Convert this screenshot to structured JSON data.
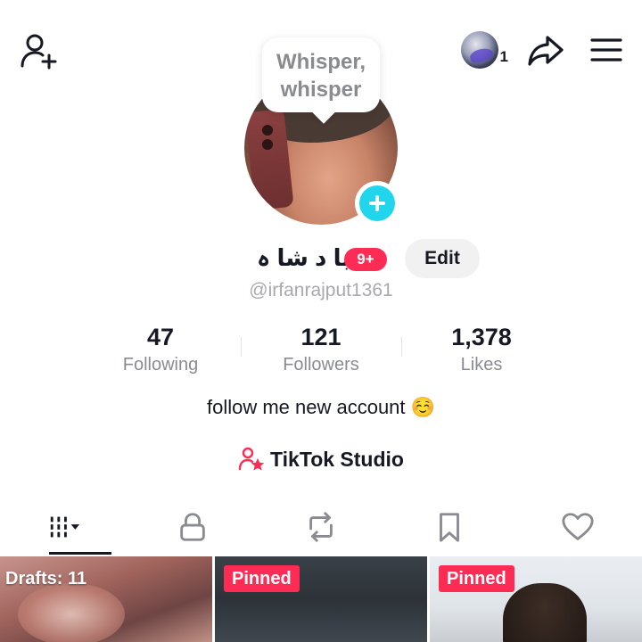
{
  "header": {
    "add_friend_icon": "add-user-icon",
    "story_count": "1",
    "share_icon": "share-icon",
    "menu_icon": "menu-icon"
  },
  "avatar": {
    "note_text": "Whisper, whisper",
    "add_icon": "plus-icon"
  },
  "profile": {
    "display_name": "با د شا ہ",
    "notification_badge": "9+",
    "edit_label": "Edit",
    "username": "@irfanrajput1361",
    "bio": "follow me new account ☺️",
    "studio_label": "TikTok Studio"
  },
  "stats": [
    {
      "value": "47",
      "label": "Following"
    },
    {
      "value": "121",
      "label": "Followers"
    },
    {
      "value": "1,378",
      "label": "Likes"
    }
  ],
  "tabs": [
    {
      "icon": "grid-videos-icon",
      "active": true
    },
    {
      "icon": "lock-icon",
      "active": false
    },
    {
      "icon": "repost-icon",
      "active": false
    },
    {
      "icon": "bookmark-icon",
      "active": false
    },
    {
      "icon": "heart-icon",
      "active": false
    }
  ],
  "videos": [
    {
      "label": "Drafts: 11"
    },
    {
      "label": "Pinned"
    },
    {
      "label": "Pinned"
    }
  ],
  "colors": {
    "accent": "#fe2c55",
    "add_button": "#20d5ec",
    "text": "#161823",
    "secondary_text": "#8a8b91"
  }
}
